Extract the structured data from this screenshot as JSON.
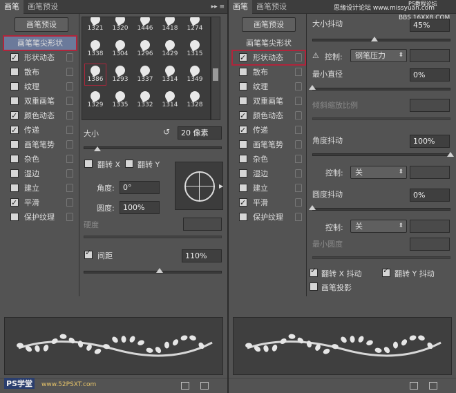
{
  "left": {
    "tabs": [
      "画笔",
      "画笔预设"
    ],
    "preset_button": "画笔预设",
    "list": [
      {
        "label": "画笔笔尖形状",
        "checked": null,
        "selected": true
      },
      {
        "label": "形状动态",
        "checked": true
      },
      {
        "label": "散布",
        "checked": false
      },
      {
        "label": "纹理",
        "checked": false
      },
      {
        "label": "双重画笔",
        "checked": false
      },
      {
        "label": "颜色动态",
        "checked": true
      },
      {
        "label": "传递",
        "checked": true
      },
      {
        "label": "画笔笔势",
        "checked": false
      },
      {
        "label": "杂色",
        "checked": false
      },
      {
        "label": "湿边",
        "checked": false
      },
      {
        "label": "建立",
        "checked": false
      },
      {
        "label": "平滑",
        "checked": true
      },
      {
        "label": "保护纹理",
        "checked": false
      }
    ],
    "brushes": [
      "1321",
      "1320",
      "1446",
      "1418",
      "1274",
      "1338",
      "1304",
      "1296",
      "1429",
      "1315",
      "1386",
      "1293",
      "1337",
      "1314",
      "1349",
      "1329",
      "1335",
      "1332",
      "1314",
      "1328"
    ],
    "selected_brush": "1386",
    "size_label": "大小",
    "size_value": "20 像素",
    "flip_x": "翻转 X",
    "flip_y": "翻转 Y",
    "angle_label": "角度:",
    "angle_value": "0°",
    "roundness_label": "圆度:",
    "roundness_value": "100%",
    "hardness_label": "硬度",
    "spacing_label": "间距",
    "spacing_value": "110%",
    "spacing_checked": true,
    "size_level": 0.1,
    "spacing_level": 0.55
  },
  "right": {
    "tabs": [
      "画笔",
      "画笔预设"
    ],
    "watermark_top": "思缘设计论坛 www.missyuan.com",
    "watermark_top2": "PS教程论坛",
    "watermark_top3": "BBS.16XX8.COM",
    "preset_button": "画笔预设",
    "list": [
      {
        "label": "画笔笔尖形状",
        "checked": null
      },
      {
        "label": "形状动态",
        "checked": true,
        "selected": true
      },
      {
        "label": "散布",
        "checked": false
      },
      {
        "label": "纹理",
        "checked": false
      },
      {
        "label": "双重画笔",
        "checked": false
      },
      {
        "label": "颜色动态",
        "checked": true
      },
      {
        "label": "传递",
        "checked": true
      },
      {
        "label": "画笔笔势",
        "checked": false
      },
      {
        "label": "杂色",
        "checked": false
      },
      {
        "label": "湿边",
        "checked": false
      },
      {
        "label": "建立",
        "checked": false
      },
      {
        "label": "平滑",
        "checked": true
      },
      {
        "label": "保护纹理",
        "checked": false
      }
    ],
    "size_jitter_label": "大小抖动",
    "size_jitter_value": "45%",
    "control_label": "控制:",
    "control1_value": "钢笔压力",
    "min_diameter_label": "最小直径",
    "min_diameter_value": "0%",
    "tilt_scale_label": "倾斜缩放比例",
    "angle_jitter_label": "角度抖动",
    "angle_jitter_value": "100%",
    "control2_value": "关",
    "roundness_jitter_label": "圆度抖动",
    "roundness_jitter_value": "0%",
    "control3_value": "关",
    "min_roundness_label": "最小圆度",
    "flip_x_jitter": "翻转 X 抖动",
    "flip_y_jitter": "翻转 Y 抖动",
    "brush_projection": "画笔投影",
    "size_jitter_level": 0.45,
    "angle_jitter_level": 1.0
  },
  "bottom_watermark": "PS学堂",
  "bottom_watermark_url": "www.52PSXT.com"
}
